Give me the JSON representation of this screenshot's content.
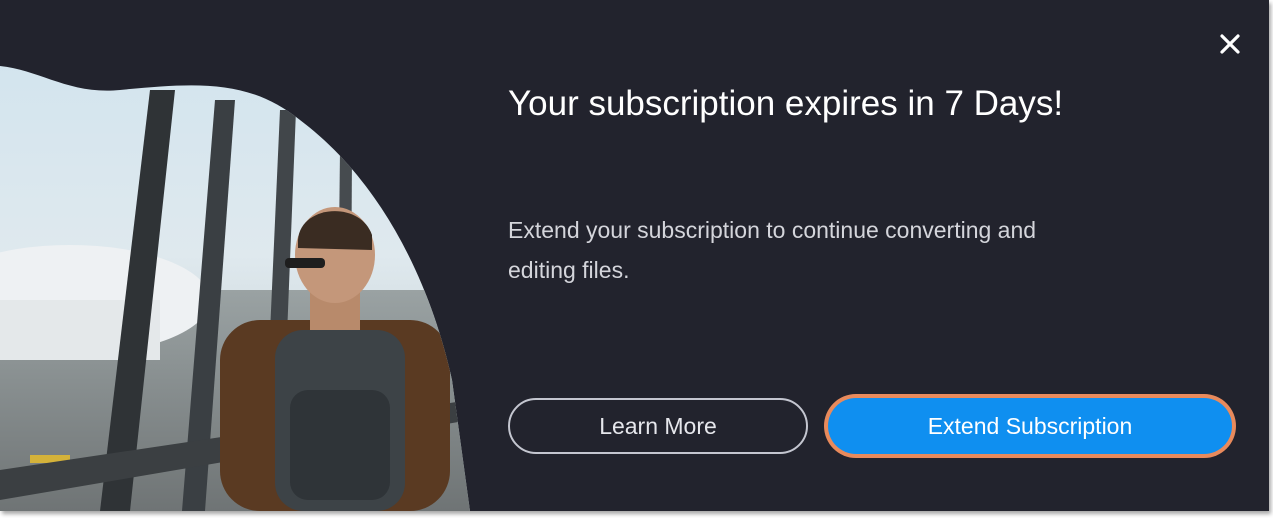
{
  "dialog": {
    "title": "Your subscription expires in 7 Days!",
    "message": "Extend your subscription to continue converting and editing files.",
    "close_icon": "close-icon",
    "buttons": {
      "learn_more": "Learn More",
      "extend": "Extend Subscription"
    },
    "colors": {
      "background": "#22232d",
      "primary_button": "#0f8ff0",
      "primary_button_highlight": "#e88a5c",
      "text": "#ffffff"
    }
  }
}
